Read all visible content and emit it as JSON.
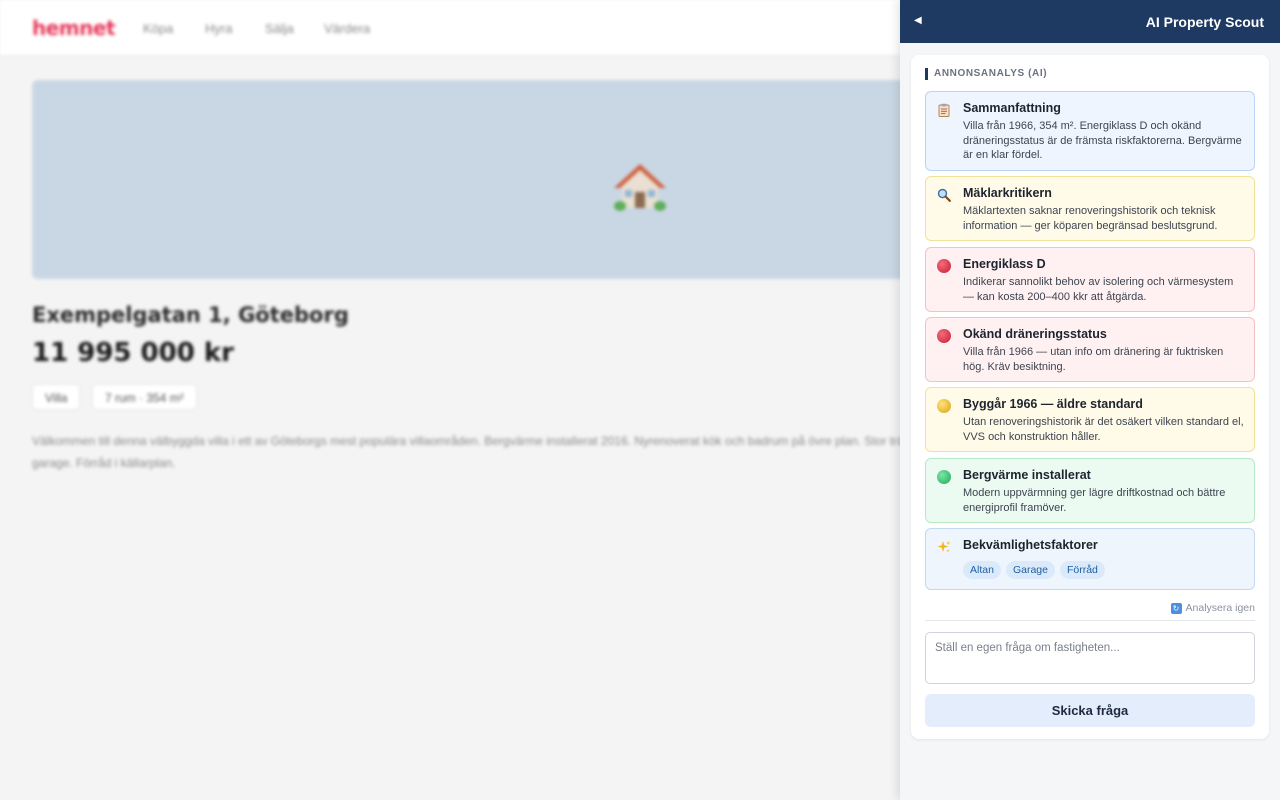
{
  "site": {
    "logo": "hemnet",
    "nav": [
      "Köpa",
      "Hyra",
      "Sälja",
      "Värdera"
    ],
    "listing": {
      "address": "Exempelgatan 1, Göteborg",
      "price": "11 995 000 kr",
      "tags": [
        "Villa",
        "7 rum · 354 m²"
      ],
      "description": "Välkommen till denna välbyggda villa i ett av Göteborgs mest populära villaområden. Bergvärme installerat 2016. Nyrenoverat kök och badrum på övre plan. Stor trädgård med altan och garage. Förråd i källarplan."
    }
  },
  "panel": {
    "title": "AI Property Scout",
    "section_label": "ANNONSANALYS (AI)",
    "insights": [
      {
        "title": "Sammanfattning",
        "text": "Villa från 1966, 354 m². Energiklass D och okänd dräneringsstatus är de främsta riskfaktorerna. Bergvärme är en klar fördel.",
        "icon": "clipboard-icon",
        "tone": "blue"
      },
      {
        "title": "Mäklarkritikern",
        "text": "Mäklartexten saknar renoveringshistorik och teknisk information — ger köparen begränsad beslutsgrund.",
        "icon": "magnifier-icon",
        "tone": "yellow"
      },
      {
        "title": "Energiklass D",
        "text": "Indikerar sannolikt behov av isolering och värmesystem — kan kosta 200–400 kkr att åtgärda.",
        "icon": "red-circle-icon",
        "tone": "red"
      },
      {
        "title": "Okänd dräneringsstatus",
        "text": "Villa från 1966 — utan info om dränering är fuktrisken hög. Kräv besiktning.",
        "icon": "red-circle-icon",
        "tone": "red"
      },
      {
        "title": "Byggår 1966 — äldre standard",
        "text": "Utan renoveringshistorik är det osäkert vilken standard el, VVS och konstruktion håller.",
        "icon": "yellow-circle-icon",
        "tone": "yellow"
      },
      {
        "title": "Bergvärme installerat",
        "text": "Modern uppvärmning ger lägre driftkostnad och bättre energiprofil framöver.",
        "icon": "green-circle-icon",
        "tone": "green"
      }
    ],
    "amenities": {
      "title": "Bekvämlighetsfaktorer",
      "icon": "sparkles-icon",
      "chips": [
        "Altan",
        "Garage",
        "Förråd"
      ]
    },
    "reanalyze_label": "Analysera igen",
    "question_placeholder": "Ställ en egen fråga om fastigheten...",
    "submit_label": "Skicka fråga"
  },
  "colors": {
    "header_bg": "#1e3a63",
    "brand": "#e63a5b",
    "risk_red": "#c81d34",
    "warn_yellow": "#d9a210",
    "good_green": "#1ea95a"
  }
}
